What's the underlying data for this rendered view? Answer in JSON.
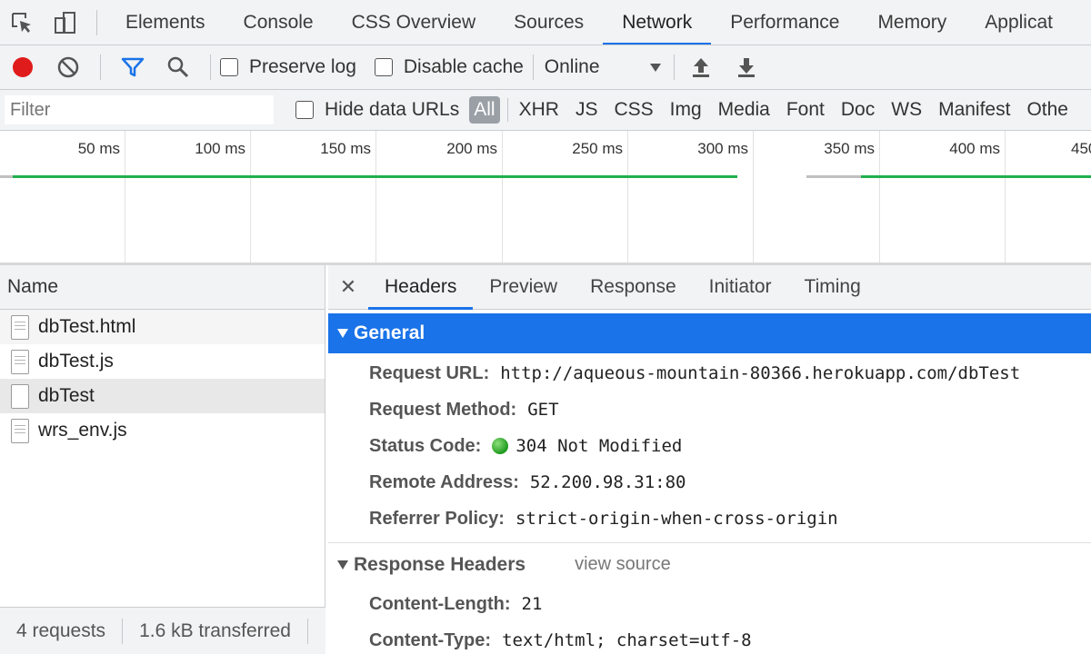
{
  "topbar": {
    "tabs": [
      "Elements",
      "Console",
      "CSS Overview",
      "Sources",
      "Network",
      "Performance",
      "Memory",
      "Applicat"
    ],
    "active": "Network"
  },
  "toolbar": {
    "preserve_log": "Preserve log",
    "disable_cache": "Disable cache",
    "throttling": "Online"
  },
  "filterbar": {
    "placeholder": "Filter",
    "hide_data_urls": "Hide data URLs",
    "types": [
      "All",
      "XHR",
      "JS",
      "CSS",
      "Img",
      "Media",
      "Font",
      "Doc",
      "WS",
      "Manifest",
      "Othe"
    ]
  },
  "overview": {
    "ticks": [
      "50 ms",
      "100 ms",
      "150 ms",
      "200 ms",
      "250 ms",
      "300 ms",
      "350 ms",
      "400 ms",
      "450"
    ]
  },
  "requests": {
    "column": "Name",
    "items": [
      "dbTest.html",
      "dbTest.js",
      "dbTest",
      "wrs_env.js"
    ],
    "status": {
      "count": "4 requests",
      "transferred": "1.6 kB transferred"
    }
  },
  "details": {
    "tabs": [
      "Headers",
      "Preview",
      "Response",
      "Initiator",
      "Timing"
    ],
    "general": {
      "title": "General",
      "rows": [
        {
          "key": "Request URL:",
          "value": "http://aqueous-mountain-80366.herokuapp.com/dbTest"
        },
        {
          "key": "Request Method:",
          "value": "GET"
        },
        {
          "key": "Status Code:",
          "value": "304 Not Modified"
        },
        {
          "key": "Remote Address:",
          "value": "52.200.98.31:80"
        },
        {
          "key": "Referrer Policy:",
          "value": "strict-origin-when-cross-origin"
        }
      ]
    },
    "response_headers": {
      "title": "Response Headers",
      "view_source": "view source",
      "rows": [
        {
          "key": "Content-Length:",
          "value": "21"
        },
        {
          "key": "Content-Type:",
          "value": "text/html; charset=utf-8"
        }
      ]
    }
  },
  "colors": {
    "accent": "#1a73e8",
    "record": "#e01b1b",
    "bar_green": "#20b04b",
    "status_green": "#1e9a1e"
  }
}
